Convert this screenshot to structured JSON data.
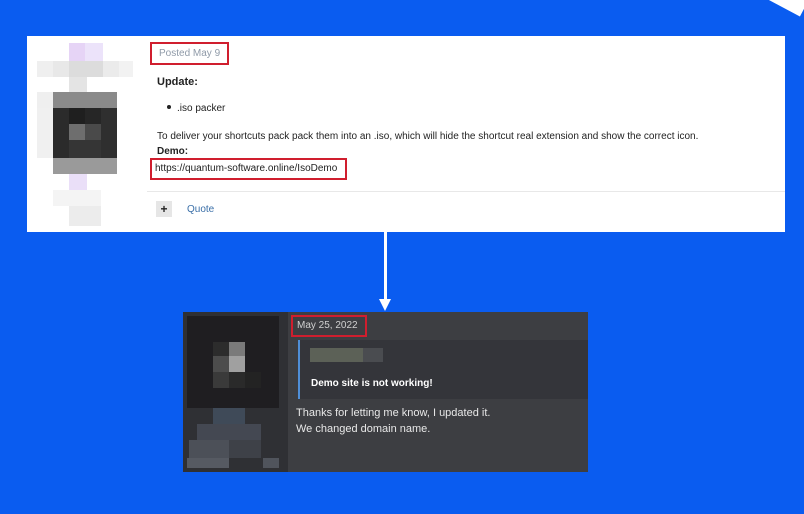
{
  "top_post": {
    "posted_date": "Posted May 9",
    "update_heading": "Update:",
    "bullet_items": [
      ".iso packer"
    ],
    "description": "To deliver your shortcuts pack pack them into an .iso, which will hide the shortcut real extension and show the correct icon.",
    "demo_label": "Demo:",
    "demo_url": "https://quantum-software.online/IsoDemo",
    "quote_label": "Quote",
    "plus_icon": "+"
  },
  "reply_post": {
    "date": "May 25, 2022",
    "quoted_text": "Demo site is not working!",
    "reply_lines": [
      "Thanks for letting me know, I updated it.",
      "We changed domain name."
    ]
  },
  "colors": {
    "background": "#0a5cf0",
    "highlight_border": "#d01e2e",
    "dark_post": "#3d3e42",
    "quote_accent": "#4f8fd8"
  }
}
